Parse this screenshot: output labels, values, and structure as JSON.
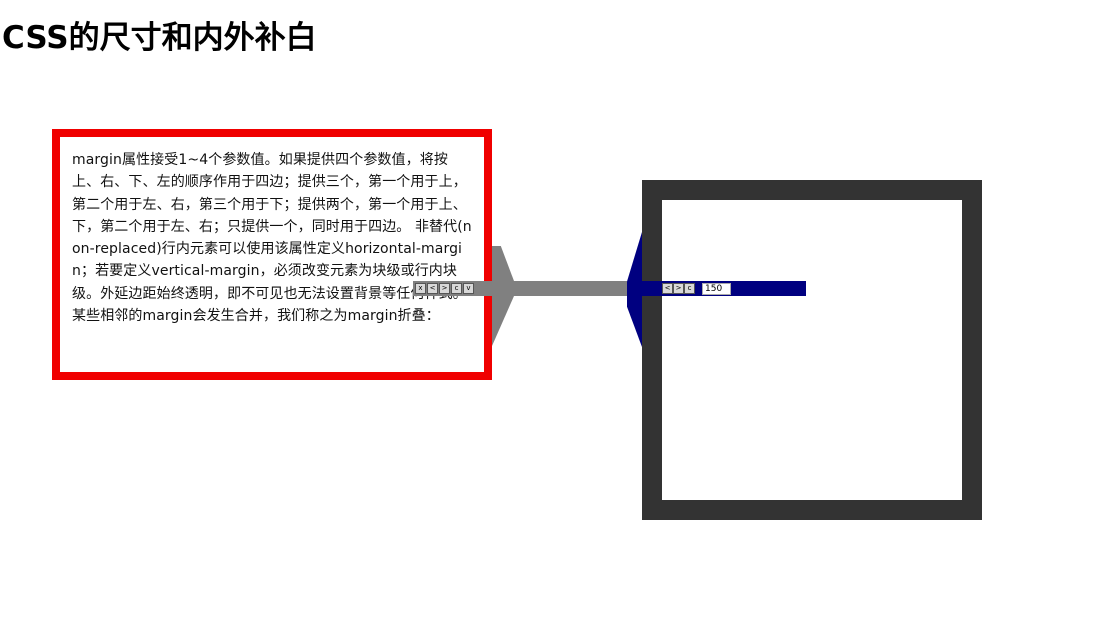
{
  "page": {
    "title": "CSS的尺寸和内外补白"
  },
  "content": {
    "description": "margin属性接受1~4个参数值。如果提供四个参数值，将按上、右、下、左的顺序作用于四边；提供三个，第一个用于上，第二个用于左、右，第三个用于下；提供两个，第一个用于上、下，第二个用于左、右；只提供一个，同时用于四边。 非替代(non-replaced)行内元素可以使用该属性定义horizontal-margin；若要定义vertical-margin，必须改变元素为块级或行内块级。外延边距始终透明，即不可见也无法设置背景等任何样式。某些相邻的margin会发生合并，我们称之为margin折叠："
  },
  "gray_controls": {
    "close": "x",
    "prev": "<",
    "next": ">",
    "c": "c",
    "v": "v"
  },
  "blue_controls": {
    "prev": "<",
    "next": ">",
    "c": "c",
    "value": "150"
  },
  "colors": {
    "text_box_border": "#f00000",
    "frame_border": "#333333",
    "gray_arm": "#808080",
    "blue_arm": "#000080"
  }
}
